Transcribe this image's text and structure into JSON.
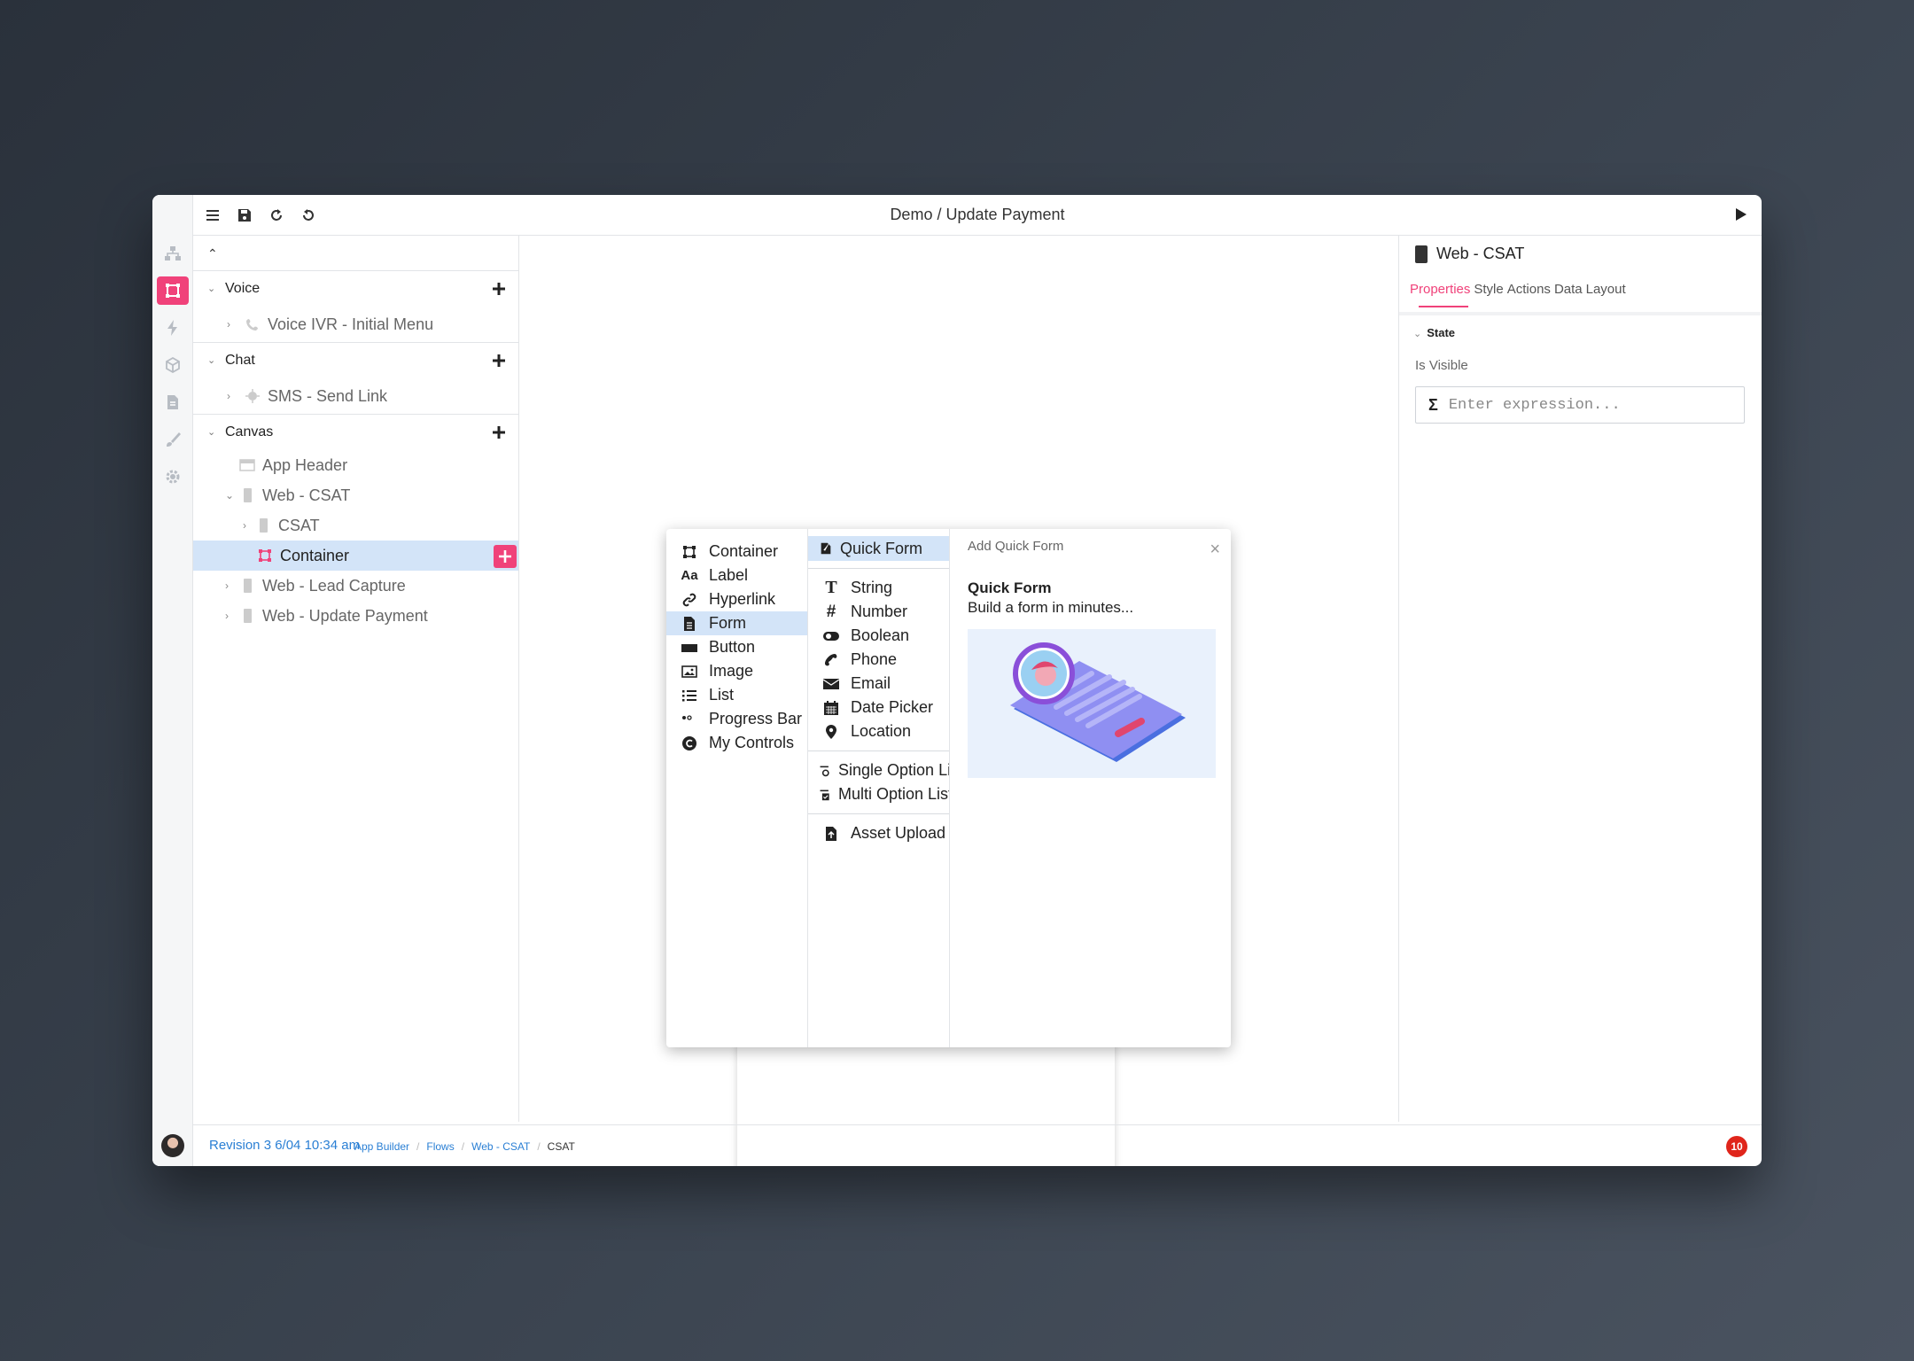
{
  "app": {
    "title": "Demo / Update Payment"
  },
  "rail": {
    "icons": [
      "sitemap-icon",
      "container-icon",
      "bolt-icon",
      "cube-icon",
      "document-icon",
      "brush-icon",
      "gear-icon"
    ]
  },
  "tree": {
    "sections": [
      {
        "title": "Voice",
        "items": [
          "Voice IVR - Initial Menu"
        ]
      },
      {
        "title": "Chat",
        "items": [
          "SMS - Send Link"
        ]
      },
      {
        "title": "Canvas",
        "items": [
          "App Header",
          "Web - CSAT",
          "CSAT",
          "Container",
          "Web - Lead Capture",
          "Web - Update Payment"
        ]
      }
    ]
  },
  "popup": {
    "controls": [
      "Container",
      "Label",
      "Hyperlink",
      "Form",
      "Button",
      "Image",
      "List",
      "Progress Bar",
      "My Controls"
    ],
    "selected_control": "Form",
    "form_items": {
      "quick": "Quick Form",
      "fields": [
        "String",
        "Number",
        "Boolean",
        "Phone",
        "Email",
        "Date Picker",
        "Location"
      ],
      "options": [
        "Single Option List",
        "Multi Option List"
      ],
      "upload": "Asset Upload"
    },
    "detail": {
      "header": "Add Quick Form",
      "close": "×",
      "title": "Quick Form",
      "description": "Build a form in minutes..."
    }
  },
  "props": {
    "title": "Web - CSAT",
    "tabs": [
      "Properties",
      "Style",
      "Actions",
      "Data",
      "Layout"
    ],
    "active_tab": "Properties",
    "section": "State",
    "field_label": "Is Visible",
    "expression_placeholder": "Enter expression..."
  },
  "footer": {
    "revision": "Revision 3  6/04 10:34 am",
    "breadcrumbs": [
      "App Builder",
      "Flows",
      "Web - CSAT",
      "CSAT"
    ],
    "notifications": "10"
  },
  "colors": {
    "accent": "#f0427a",
    "selection": "#d3e4f8",
    "link": "#2a7fd4",
    "badge": "#e0251b"
  }
}
